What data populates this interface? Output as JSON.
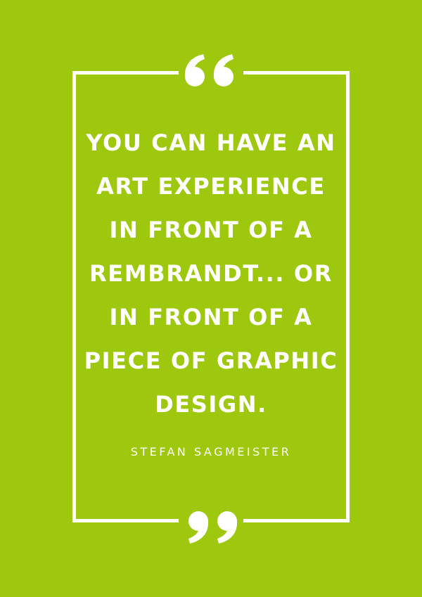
{
  "poster": {
    "background_color": "#9dc80d",
    "text_color": "#ffffff",
    "open_quote_icon": "open-quote-icon",
    "close_quote_icon": "close-quote-icon"
  },
  "quote": {
    "lines": [
      "YOU CAN HAVE AN",
      "ART EXPERIENCE",
      "IN FRONT OF A",
      "REMBRANDT... OR",
      "IN FRONT OF A",
      "PIECE OF GRAPHIC",
      "DESIGN."
    ]
  },
  "author": {
    "name": "STEFAN SAGMEISTER"
  }
}
